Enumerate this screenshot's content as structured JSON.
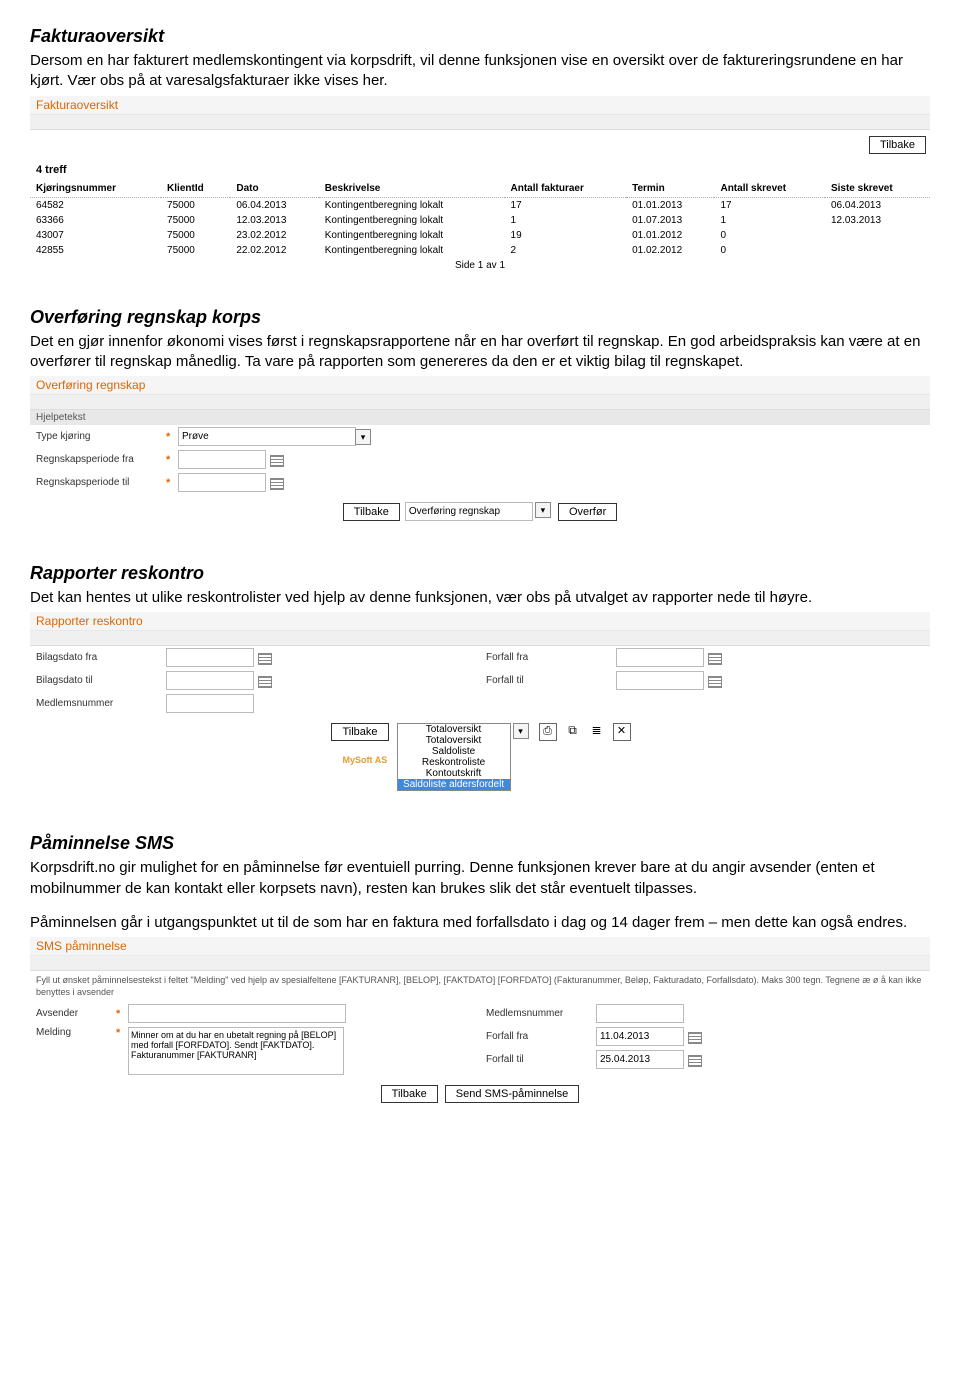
{
  "s1": {
    "heading": "Fakturaoversikt",
    "body": "Dersom en har fakturert medlemskontingent via korpsdrift, vil denne funksjonen vise en oversikt over de faktureringsrundene en har kjørt. Vær obs på at varesalgsfakturaer ikke vises her."
  },
  "fo": {
    "title": "Fakturaoversikt",
    "back": "Tilbake",
    "hits": "4 treff",
    "headers": [
      "Kjøringsnummer",
      "KlientId",
      "Dato",
      "Beskrivelse",
      "Antall fakturaer",
      "Termin",
      "Antall skrevet",
      "Siste skrevet"
    ],
    "rows": [
      [
        "64582",
        "75000",
        "06.04.2013",
        "Kontingentberegning lokalt",
        "17",
        "01.01.2013",
        "17",
        "06.04.2013"
      ],
      [
        "63366",
        "75000",
        "12.03.2013",
        "Kontingentberegning lokalt",
        "1",
        "01.07.2013",
        "1",
        "12.03.2013"
      ],
      [
        "43007",
        "75000",
        "23.02.2012",
        "Kontingentberegning lokalt",
        "19",
        "01.01.2012",
        "0",
        ""
      ],
      [
        "42855",
        "75000",
        "22.02.2012",
        "Kontingentberegning lokalt",
        "2",
        "01.02.2012",
        "0",
        ""
      ]
    ],
    "pager": "Side 1 av 1"
  },
  "s2": {
    "heading": "Overføring regnskap korps",
    "body": "Det en gjør innenfor økonomi vises først i regnskapsrapportene når en har overført til regnskap. En god arbeidspraksis kan være at en overfører til regnskap månedlig. Ta vare på rapporten som genereres da den er et viktig bilag til regnskapet."
  },
  "or": {
    "title": "Overføring regnskap",
    "sub": "Hjelpetekst",
    "f1": "Type kjøring",
    "f1val": "Prøve",
    "f2": "Regnskapsperiode fra",
    "f3": "Regnskapsperiode til",
    "back": "Tilbake",
    "selectLabel": "Overføring regnskap",
    "go": "Overfør"
  },
  "s3": {
    "heading": "Rapporter reskontro",
    "body": "Det kan hentes ut ulike reskontrolister ved hjelp av denne funksjonen, vær obs på utvalget av rapporter nede til høyre."
  },
  "rr": {
    "title": "Rapporter reskontro",
    "l1": "Bilagsdato fra",
    "l2": "Bilagsdato til",
    "l3": "Medlemsnummer",
    "r1": "Forfall fra",
    "r2": "Forfall til",
    "back": "Tilbake",
    "opts": [
      "Totaloversikt",
      "Totaloversikt",
      "Saldoliste",
      "Reskontroliste",
      "Kontoutskrift",
      "Saldoliste aldersfordelt"
    ],
    "brand": "MySoft AS"
  },
  "s4": {
    "heading": "Påminnelse SMS",
    "p1": "Korpsdrift.no gir mulighet for en påminnelse før eventuiell purring. Denne funksjonen krever bare at du angir avsender (enten et mobilnummer de kan kontakt eller korpsets navn), resten kan brukes slik det står eventuelt tilpasses.",
    "p2": "Påminnelsen går i utgangspunktet ut til de som har en faktura med forfallsdato i dag og 14 dager frem – men dette kan også endres."
  },
  "sms": {
    "title": "SMS påminnelse",
    "instr": "Fyll ut ønsket påminnelsestekst i feltet \"Melding\" ved hjelp av spesialfeltene [FAKTURANR], [BELOP], [FAKTDATO] [FORFDATO] (Fakturanummer, Beløp, Fakturadato, Forfallsdato). Maks 300 tegn. Tegnene æ ø å kan ikke benyttes i avsender",
    "lA": "Avsender",
    "lB": "Melding",
    "msg": "Minner om at du har en ubetalt regning på [BELOP] med forfall [FORFDATO]. Sendt [FAKTDATO]. Fakturanummer [FAKTURANR]",
    "rA": "Medlemsnummer",
    "rB": "Forfall fra",
    "rBval": "11.04.2013",
    "rC": "Forfall til",
    "rCval": "25.04.2013",
    "back": "Tilbake",
    "send": "Send SMS-påminnelse"
  }
}
